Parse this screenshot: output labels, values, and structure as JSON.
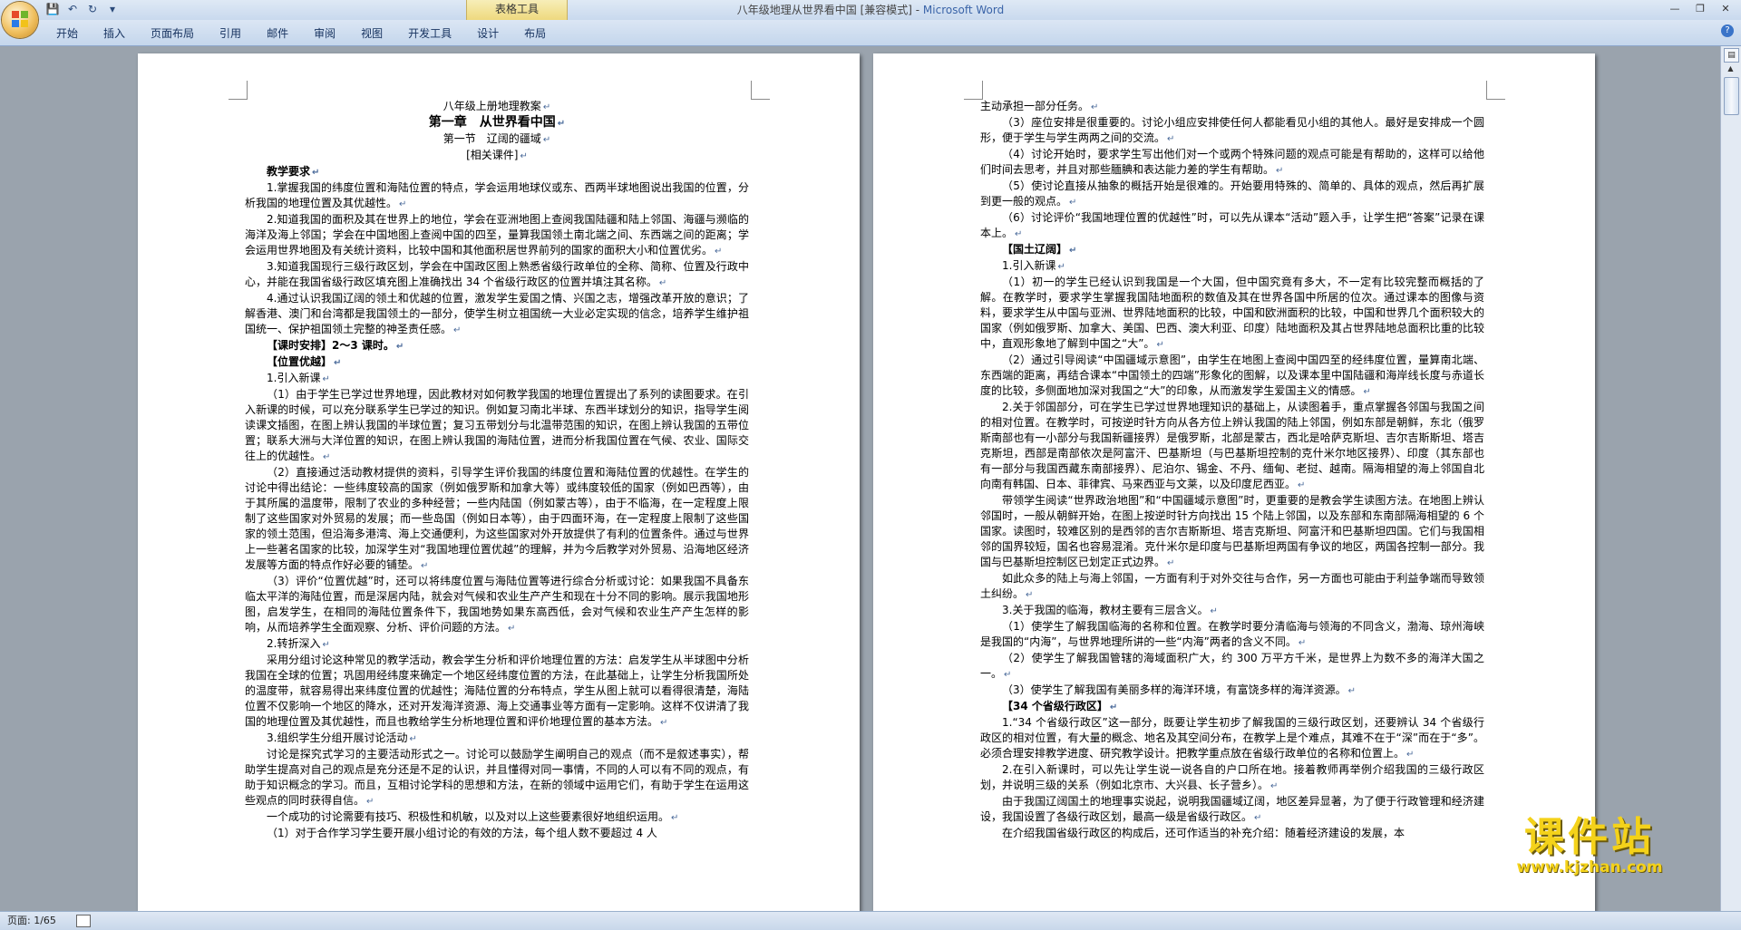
{
  "window": {
    "title": "八年级地理从世界看中国 [兼容模式] - ",
    "app_name": "Microsoft Word",
    "context_tab_group": "表格工具"
  },
  "ribbon": {
    "tabs": [
      "开始",
      "插入",
      "页面布局",
      "引用",
      "邮件",
      "审阅",
      "视图",
      "开发工具",
      "设计",
      "布局"
    ]
  },
  "status_bar": {
    "page_info": "页面: 1/65"
  },
  "watermark": {
    "text": "课件站",
    "url": "www.kjzhan.com"
  },
  "page1": {
    "header_line": "八年级上册地理教案",
    "chapter": "第一章　从世界看中国",
    "section": "第一节　辽阔的疆域",
    "materials": "[相关课件]",
    "teaching_req_heading": "教学要求",
    "req1": "1.掌握我国的纬度位置和海陆位置的特点，学会运用地球仪或东、西两半球地图说出我国的位置，分析我国的地理位置及其优越性。",
    "req2": "2.知道我国的面积及其在世界上的地位，学会在亚洲地图上查阅我国陆疆和陆上邻国、海疆与濒临的海洋及海上邻国；学会在中国地图上查阅中国的四至，量算我国领土南北端之间、东西端之间的距离；学会运用世界地图及有关统计资料，比较中国和其他面积居世界前列的国家的面积大小和位置优劣。",
    "req3": "3.知道我国现行三级行政区划，学会在中国政区图上熟悉省级行政单位的全称、简称、位置及行政中心，并能在我国省级行政区填充图上准确找出 34 个省级行政区的位置并填注其名称。",
    "req4": "4.通过认识我国辽阔的领土和优越的位置，激发学生爱国之情、兴国之志，增强改革开放的意识；了解香港、澳门和台湾都是我国领土的一部分，使学生树立祖国统一大业必定实现的信念，培养学生维护祖国统一、保护祖国领土完整的神圣责任感。",
    "hours": "【课时安排】2～3 课时。",
    "location_heading": "【位置优越】",
    "intro_new": "1.引入新课",
    "p_1_1": "（1）由于学生已学过世界地理，因此教材对如何教学我国的地理位置提出了系列的读图要求。在引入新课的时候，可以充分联系学生已学过的知识。例如复习南北半球、东西半球划分的知识，指导学生阅读课文插图，在图上辨认我国的半球位置；复习五带划分与北温带范围的知识，在图上辨认我国的五带位置；联系大洲与大洋位置的知识，在图上辨认我国的海陆位置，进而分析我国位置在气候、农业、国际交往上的优越性。",
    "p_1_2": "（2）直接通过活动教材提供的资料，引导学生评价我国的纬度位置和海陆位置的优越性。在学生的讨论中得出结论：一些纬度较高的国家（例如俄罗斯和加拿大等）或纬度较低的国家（例如巴西等），由于其所属的温度带，限制了农业的多种经营；一些内陆国（例如蒙古等），由于不临海，在一定程度上限制了这些国家对外贸易的发展；而一些岛国（例如日本等），由于四面环海，在一定程度上限制了这些国家的领土范围，但沿海多港湾、海上交通便利，为这些国家对外开放提供了有利的位置条件。通过与世界上一些著名国家的比较，加深学生对“我国地理位置优越”的理解，并为今后教学对外贸易、沿海地区经济发展等方面的特点作好必要的铺垫。",
    "p_1_3": "（3）评价“位置优越”时，还可以将纬度位置与海陆位置等进行综合分析或讨论：如果我国不具备东临太平洋的海陆位置，而是深居内陆，就会对气候和农业生产产生和现在十分不同的影响。展示我国地形图，启发学生，在相同的海陆位置条件下，我国地势如果东高西低，会对气候和农业生产产生怎样的影响，从而培养学生全面观察、分析、评价问题的方法。",
    "transition": "2.转折深入",
    "p_2": "采用分组讨论这种常见的教学活动，教会学生分析和评价地理位置的方法：启发学生从半球图中分析我国在全球的位置；巩固用经纬度来确定一个地区经纬度位置的方法，在此基础上，让学生分析我国所处的温度带，就容易得出来纬度位置的优越性；海陆位置的分布特点，学生从图上就可以看得很清楚，海陆位置不仅影响一个地区的降水，还对开发海洋资源、海上交通事业等方面有一定影响。这样不仅讲清了我国的地理位置及其优越性，而且也教给学生分析地理位置和评价地理位置的基本方法。",
    "group_discussion": "3.组织学生分组开展讨论活动",
    "p_3": "讨论是探究式学习的主要活动形式之一。讨论可以鼓励学生阐明自己的观点（而不是叙述事实），帮助学生提高对自己的观点是充分还是不足的认识，并且懂得对同一事情，不同的人可以有不同的观点，有助于知识概念的学习。而且，互相讨论学科的思想和方法，在新的领域中运用它们，有助于学生在运用这些观点的同时获得自信。",
    "p_4": "一个成功的讨论需要有技巧、积极性和机敏，以及对以上这些要素很好地组织运用。",
    "p_5": "（1）对于合作学习学生要开展小组讨论的有效的方法，每个组人数不要超过 4 人"
  },
  "page2": {
    "l1": "主动承担一部分任务。",
    "l2": "（3）座位安排是很重要的。讨论小组应安排使任何人都能看见小组的其他人。最好是安排成一个圆形，便于学生与学生两两之间的交流。",
    "l3": "（4）讨论开始时，要求学生写出他们对一个或两个特殊问题的观点可能是有帮助的，这样可以给他们时间去思考，并且对那些腼腆和表达能力差的学生有帮助。",
    "l4": "（5）使讨论直接从抽象的概括开始是很难的。开始要用特殊的、简单的、具体的观点，然后再扩展到更一般的观点。",
    "l5": "（6）讨论评价“我国地理位置的优越性”时，可以先从课本“活动”题入手，让学生把“答案”记录在课本上。",
    "territory_heading": "【国土辽阔】",
    "t_intro": "1.引入新课",
    "t1": "（1）初一的学生已经认识到我国是一个大国，但中国究竟有多大，不一定有比较完整而概括的了解。在教学时，要求学生掌握我国陆地面积的数值及其在世界各国中所居的位次。通过课本的图像与资料，要求学生从中国与亚洲、世界陆地面积的比较，中国和欧洲面积的比较，中国和世界几个面积较大的国家（例如俄罗斯、加拿大、美国、巴西、澳大利亚、印度）陆地面积及其占世界陆地总面积比重的比较中，直观形象地了解到中国之“大”。",
    "t2": "（2）通过引导阅读“中国疆域示意图”，由学生在地图上查阅中国四至的经纬度位置，量算南北端、东西端的距离，再结合课本“中国领土的四端”形象化的图解，以及课本里中国陆疆和海岸线长度与赤道长度的比较，多侧面地加深对我国之“大”的印象，从而激发学生爱国主义的情感。",
    "neighbors": "2.关于邻国部分，可在学生已学过世界地理知识的基础上，从读图着手，重点掌握各邻国与我国之间的相对位置。在教学时，可按逆时针方向从各方位上辨认我国的陆上邻国，例如东部是朝鲜，东北（俄罗斯南部也有一小部分与我国新疆接界）是俄罗斯，北部是蒙古，西北是哈萨克斯坦、吉尔吉斯斯坦、塔吉克斯坦，西部是南部依次是阿富汗、巴基斯坦（与巴基斯坦控制的克什米尔地区接界）、印度（其东部也有一部分与我国西藏东南部接界）、尼泊尔、锡金、不丹、缅甸、老挝、越南。隔海相望的海上邻国自北向南有韩国、日本、菲律宾、马来西亚与文莱，以及印度尼西亚。",
    "map_reading": "带领学生阅读“世界政治地图”和“中国疆域示意图”时，更重要的是教会学生读图方法。在地图上辨认邻国时，一般从朝鲜开始，在图上按逆时针方向找出 15 个陆上邻国，以及东部和东南部隔海相望的 6 个国家。读图时，较难区别的是西邻的吉尔吉斯斯坦、塔吉克斯坦、阿富汗和巴基斯坦四国。它们与我国相邻的国界较短，国名也容易混淆。克什米尔是印度与巴基斯坦两国有争议的地区，两国各控制一部分。我国与巴基斯坦控制区已划定正式边界。",
    "many_neighbors": "如此众多的陆上与海上邻国，一方面有利于对外交往与合作，另一方面也可能由于利益争端而导致领土纠纷。",
    "seas": "3.关于我国的临海，教材主要有三层含义。",
    "s1": "（1）使学生了解我国临海的名称和位置。在教学时要分清临海与领海的不同含义，渤海、琼州海峡是我国的“内海”，与世界地理所讲的一些“内海”两者的含义不同。",
    "s2": "（2）使学生了解我国管辖的海域面积广大，约 300 万平方千米，是世界上为数不多的海洋大国之一。",
    "s3": "（3）使学生了解我国有美丽多样的海洋环境，有富饶多样的海洋资源。",
    "provinces_heading": "【34 个省级行政区】",
    "pv1": "1.“34 个省级行政区”这一部分，既要让学生初步了解我国的三级行政区划，还要辨认 34 个省级行政区的相对位置，有大量的概念、地名及其空间分布，在教学上是个难点，其难不在于“深”而在于“多”。必须合理安排教学进度、研究教学设计。把教学重点放在省级行政单位的名称和位置上。",
    "pv2": "2.在引入新课时，可以先让学生说一说各自的户口所在地。接着教师再举例介绍我国的三级行政区划，并说明三级的关系（例如北京市、大兴县、长子营乡）。",
    "pv3": "由于我国辽阔国土的地理事实说起，说明我国疆域辽阔，地区差异显著，为了便于行政管理和经济建设，我国设置了各级行政区划，最高一级是省级行政区。",
    "pv4": "在介绍我国省级行政区的构成后，还可作适当的补充介绍：随着经济建设的发展，本"
  }
}
